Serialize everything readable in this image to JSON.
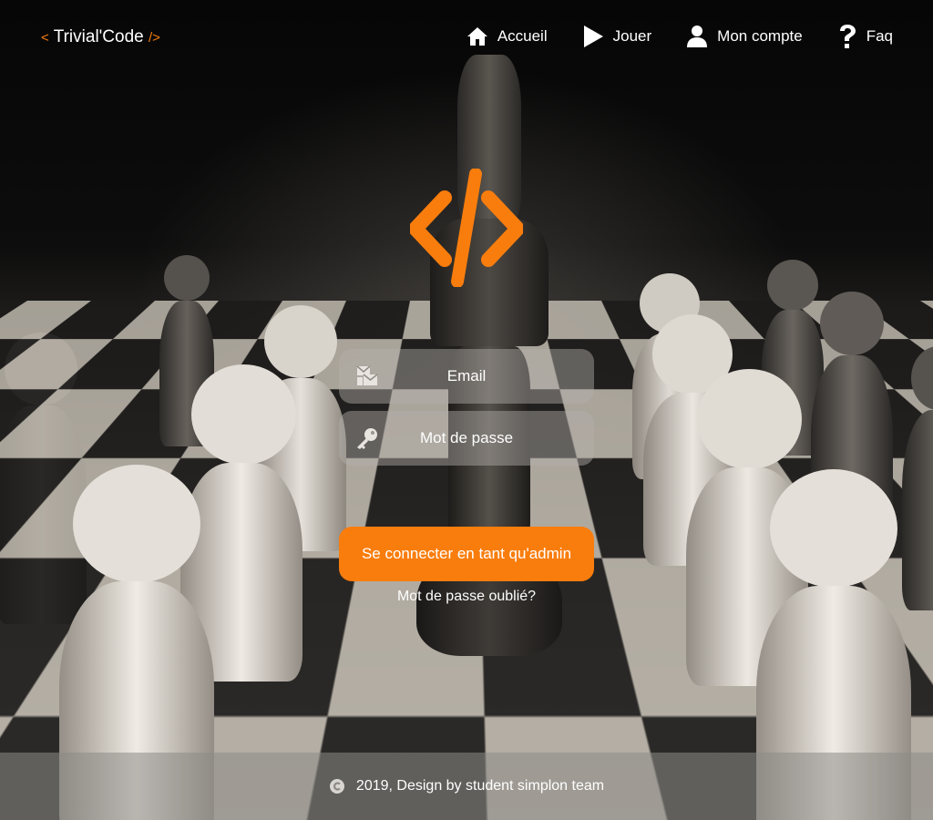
{
  "colors": {
    "accent": "#f97d0d",
    "text": "#ffffff"
  },
  "brand": {
    "open": "<",
    "name": "Trivial'Code",
    "close": "/>"
  },
  "nav": {
    "items": [
      {
        "label": "Accueil",
        "icon": "home-icon"
      },
      {
        "label": "Jouer",
        "icon": "play-icon"
      },
      {
        "label": "Mon compte",
        "icon": "user-icon"
      },
      {
        "label": "Faq",
        "icon": "question-icon"
      }
    ]
  },
  "logo": {
    "icon": "code-slash-icon"
  },
  "form": {
    "email_placeholder": "Email",
    "email_icon": "mail-stack-icon",
    "password_placeholder": "Mot de passe",
    "password_icon": "key-icon",
    "submit_label": "Se connecter en tant qu'admin",
    "forgot_label": "Mot de passe oublié?"
  },
  "footer": {
    "icon": "copyright-icon",
    "text": "2019, Design by student simplon team"
  }
}
